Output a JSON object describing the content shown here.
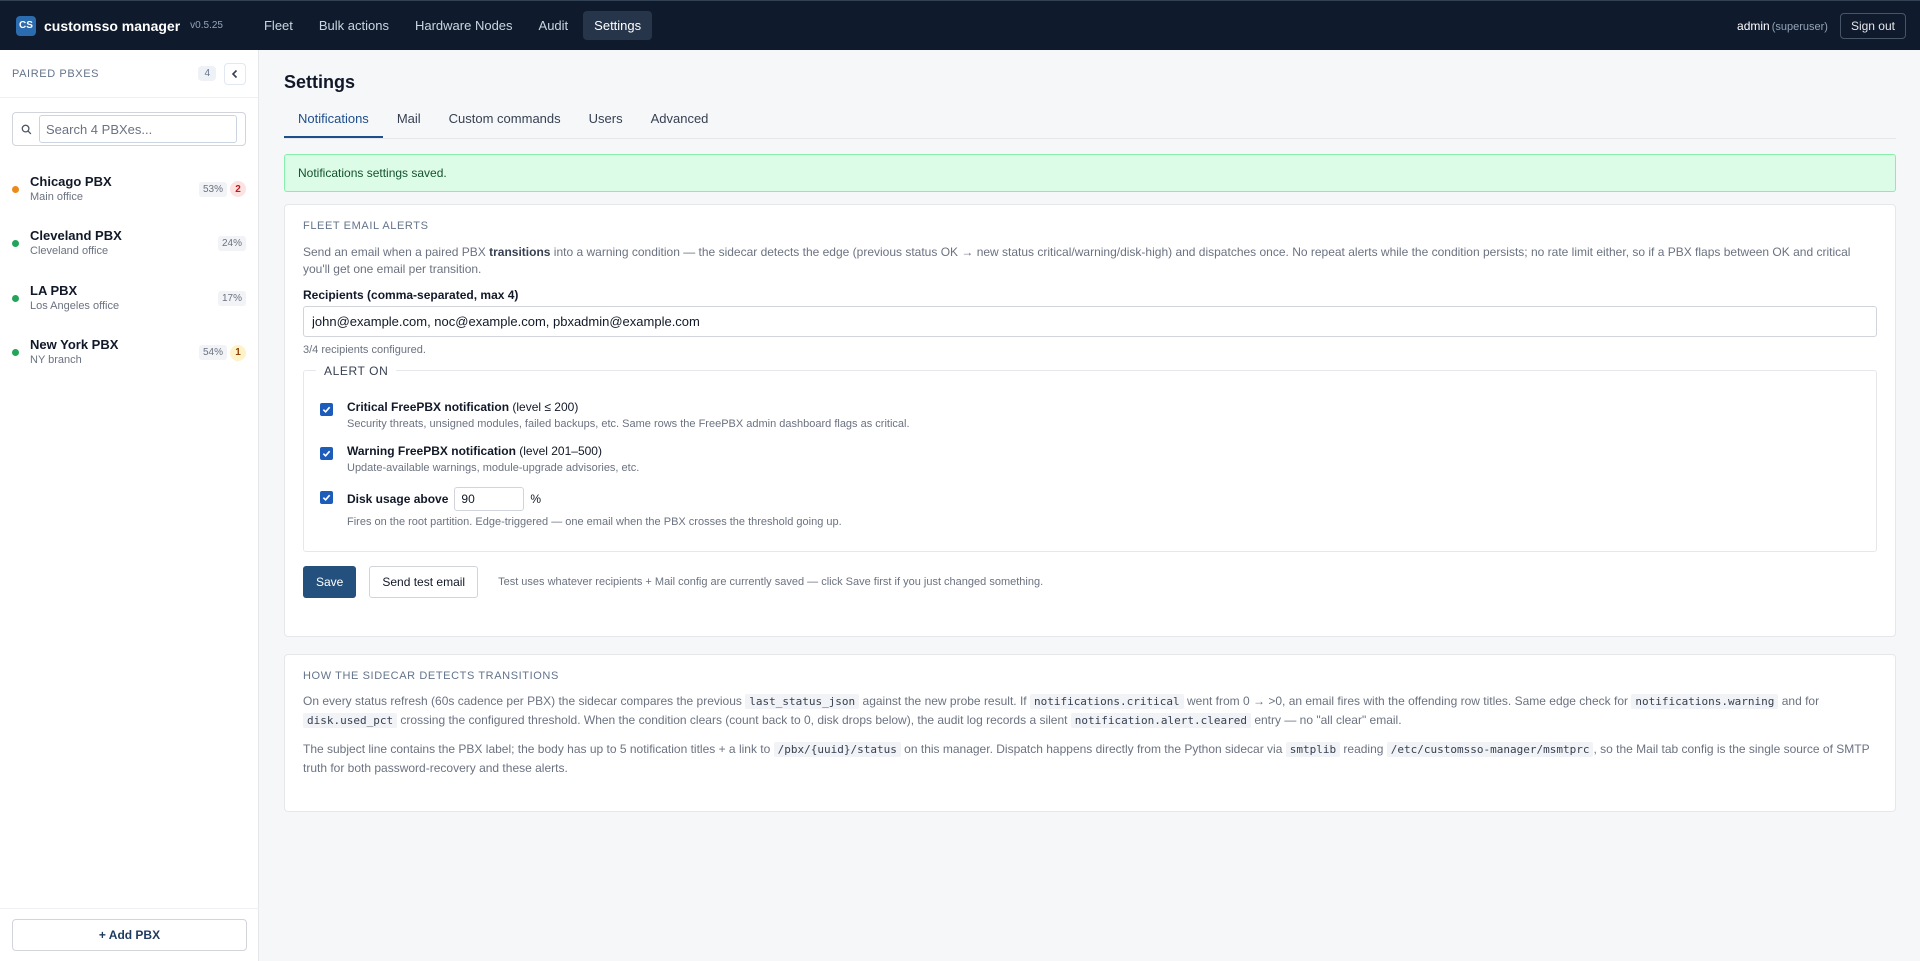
{
  "app": {
    "logo": "CS",
    "name": "customsso manager",
    "version": "v0.5.25"
  },
  "nav": [
    {
      "label": "Fleet"
    },
    {
      "label": "Bulk actions"
    },
    {
      "label": "Hardware Nodes"
    },
    {
      "label": "Audit"
    },
    {
      "label": "Settings"
    }
  ],
  "user": {
    "name": "admin",
    "role": "(superuser)",
    "signout": "Sign out"
  },
  "sidebar": {
    "title": "PAIRED PBXES",
    "count": "4",
    "search_placeholder": "Search 4 PBXes...",
    "add_label": "+ Add PBX",
    "items": [
      {
        "name": "Chicago PBX",
        "sub": "Main office",
        "pct": "53%",
        "badge": "2",
        "status_color": "#ea8a1a",
        "badge_kind": "red"
      },
      {
        "name": "Cleveland PBX",
        "sub": "Cleveland office",
        "pct": "24%",
        "badge": "",
        "status_color": "#22a55a",
        "badge_kind": ""
      },
      {
        "name": "LA PBX",
        "sub": "Los Angeles office",
        "pct": "17%",
        "badge": "",
        "status_color": "#22a55a",
        "badge_kind": ""
      },
      {
        "name": "New York PBX",
        "sub": "NY branch",
        "pct": "54%",
        "badge": "1",
        "status_color": "#22a55a",
        "badge_kind": "yellow"
      }
    ]
  },
  "page": {
    "title": "Settings",
    "tabs": [
      {
        "label": "Notifications"
      },
      {
        "label": "Mail"
      },
      {
        "label": "Custom commands"
      },
      {
        "label": "Users"
      },
      {
        "label": "Advanced"
      }
    ],
    "toast": "Notifications settings saved."
  },
  "alerts": {
    "title": "FLEET EMAIL ALERTS",
    "desc_pre": "Send an email when a paired PBX ",
    "desc_bold": "transitions",
    "desc_post": " into a warning condition — the sidecar detects the edge (previous status OK → new status critical/warning/disk-high) and dispatches once. No repeat alerts while the condition persists; no rate limit either, so if a PBX flaps between OK and critical you'll get one email per transition.",
    "recipients_label": "Recipients (comma-separated, max 4)",
    "recipients_value": "john@example.com, noc@example.com, pbxadmin@example.com",
    "recipients_helper": "3/4 recipients configured.",
    "legend": "ALERT ON",
    "options": [
      {
        "title": "Critical FreePBX notification",
        "qualifier": " (level ≤ 200)",
        "sub": "Security threats, unsigned modules, failed backups, etc. Same rows the FreePBX admin dashboard flags as critical.",
        "checked": true
      },
      {
        "title": "Warning FreePBX notification",
        "qualifier": " (level 201–500)",
        "sub": "Update-available warnings, module-upgrade advisories, etc.",
        "checked": true
      }
    ],
    "disk": {
      "title": "Disk usage above",
      "value": "90",
      "unit": "%",
      "sub": "Fires on the root partition. Edge-triggered — one email when the PBX crosses the threshold going up.",
      "checked": true
    },
    "save_label": "Save",
    "test_label": "Send test email",
    "action_note": "Test uses whatever recipients + Mail config are currently saved — click Save first if you just changed something."
  },
  "how": {
    "title": "HOW THE SIDECAR DETECTS TRANSITIONS",
    "p1": [
      {
        "t": "On every status refresh (60s cadence per PBX) the sidecar compares the previous "
      },
      {
        "c": "last_status_json"
      },
      {
        "t": " against the new probe result. If "
      },
      {
        "c": "notifications.critical"
      },
      {
        "t": " went from 0 → >0, an email fires with the offending row titles. Same edge check for "
      },
      {
        "c": "notifications.warning"
      },
      {
        "t": " and for "
      },
      {
        "c": "disk.used_pct"
      },
      {
        "t": " crossing the configured threshold. When the condition clears (count back to 0, disk drops below), the audit log records a silent "
      },
      {
        "c": "notification.alert.cleared"
      },
      {
        "t": " entry — no \"all clear\" email."
      }
    ],
    "p2": [
      {
        "t": "The subject line contains the PBX label; the body has up to 5 notification titles + a link to "
      },
      {
        "c": "/pbx/{uuid}/status"
      },
      {
        "t": " on this manager. Dispatch happens directly from the Python sidecar via "
      },
      {
        "c": "smtplib"
      },
      {
        "t": " reading "
      },
      {
        "c": "/etc/customsso-manager/msmtprc"
      },
      {
        "t": ", so the Mail tab config is the single source of SMTP truth for both password-recovery and these alerts."
      }
    ]
  }
}
